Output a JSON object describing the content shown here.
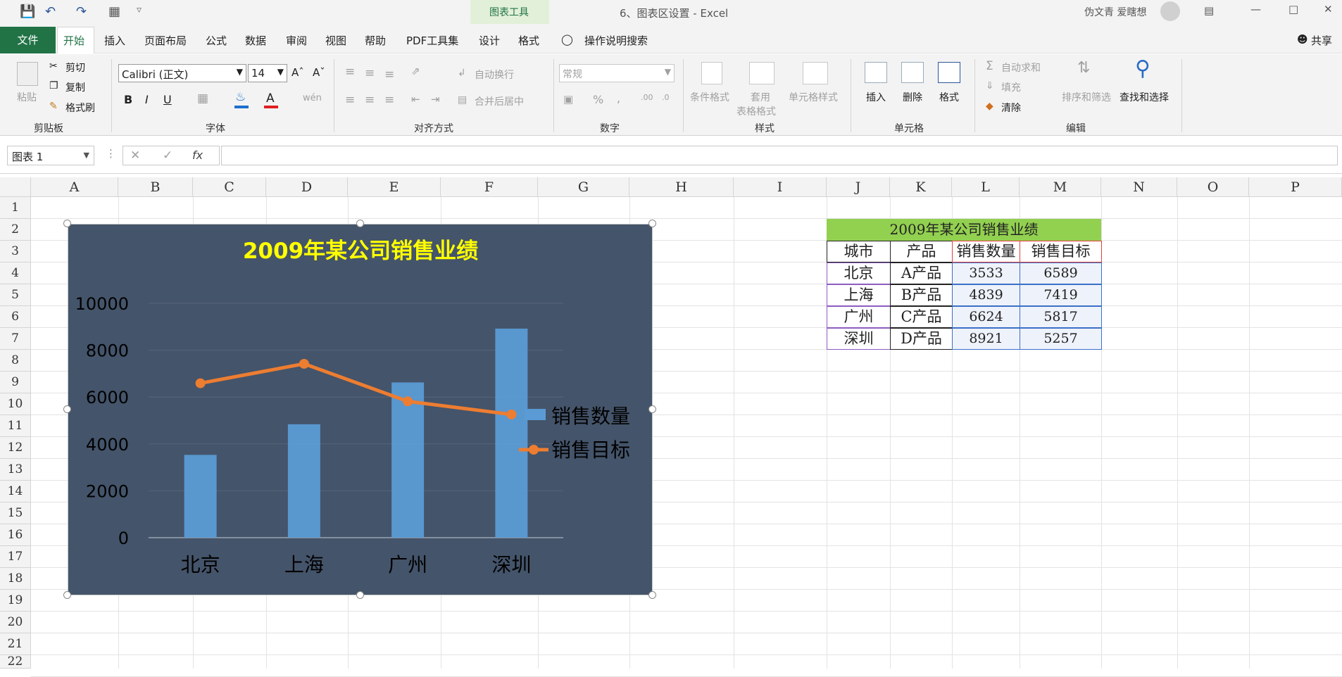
{
  "app": {
    "title": "6、图表区设置 - Excel",
    "user": "伪文青 爱瞎想",
    "context_tools": "图表工具",
    "share": "共享"
  },
  "menu": [
    "文件",
    "开始",
    "插入",
    "页面布局",
    "公式",
    "数据",
    "审阅",
    "视图",
    "帮助",
    "PDF工具集",
    "设计",
    "格式"
  ],
  "search_hint": "操作说明搜索",
  "ribbon": {
    "clipboard": {
      "paste": "粘贴",
      "cut": "剪切",
      "copy": "复制",
      "format_painter": "格式刷",
      "label": "剪贴板"
    },
    "font": {
      "name": "Calibri (正文)",
      "size": "14",
      "bold": "B",
      "italic": "I",
      "underline": "U",
      "label": "字体"
    },
    "align": {
      "wrap": "自动换行",
      "merge": "合并后居中",
      "label": "对齐方式"
    },
    "number": {
      "format": "常规",
      "label": "数字"
    },
    "styles": {
      "cond": "条件格式",
      "table_fmt_1": "套用",
      "table_fmt_2": "表格格式",
      "cell_style": "单元格样式",
      "label": "样式"
    },
    "cells": {
      "insert": "插入",
      "delete": "删除",
      "format": "格式",
      "label": "单元格"
    },
    "edit": {
      "autosum": "自动求和",
      "fill": "填充",
      "clear": "清除",
      "sort": "排序和筛选",
      "find": "查找和选择",
      "label": "编辑"
    }
  },
  "namebox": "图表 1",
  "fx": "fx",
  "columns": [
    "A",
    "B",
    "C",
    "D",
    "E",
    "F",
    "G",
    "H",
    "I",
    "J",
    "K",
    "L",
    "M",
    "N",
    "O",
    "P"
  ],
  "rows": [
    "1",
    "2",
    "3",
    "4",
    "5",
    "6",
    "7",
    "8",
    "9",
    "10",
    "11",
    "12",
    "13",
    "14",
    "15",
    "16",
    "17",
    "18",
    "19",
    "20",
    "21",
    "22"
  ],
  "table": {
    "title": "2009年某公司销售业绩",
    "headers": [
      "城市",
      "产品",
      "销售数量",
      "销售目标"
    ],
    "rows": [
      [
        "北京",
        "A产品",
        "3533",
        "6589"
      ],
      [
        "上海",
        "B产品",
        "4839",
        "7419"
      ],
      [
        "广州",
        "C产品",
        "6624",
        "5817"
      ],
      [
        "深圳",
        "D产品",
        "8921",
        "5257"
      ]
    ]
  },
  "chart_data": {
    "type": "bar",
    "title": "2009年某公司销售业绩",
    "categories": [
      "北京",
      "上海",
      "广州",
      "深圳"
    ],
    "series": [
      {
        "name": "销售数量",
        "type": "bar",
        "values": [
          3533,
          4839,
          6624,
          8921
        ]
      },
      {
        "name": "销售目标",
        "type": "line",
        "values": [
          6589,
          7419,
          5817,
          5257
        ]
      }
    ],
    "ylim": [
      0,
      10000
    ],
    "yticks": [
      "0",
      "2000",
      "4000",
      "6000",
      "8000",
      "10000"
    ],
    "grid": true,
    "legend": "right",
    "colors": {
      "background": "#44546a",
      "bar": "#5b9bd5",
      "line": "#ed7d31",
      "title": "#ffff00",
      "text": "#000000"
    }
  }
}
